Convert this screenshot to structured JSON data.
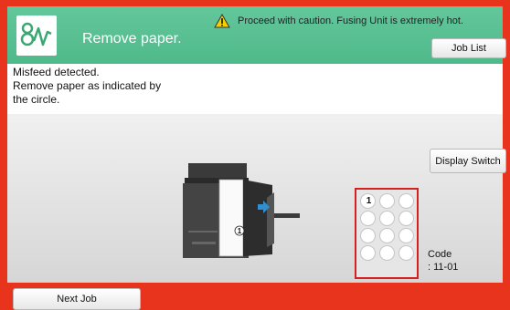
{
  "header": {
    "title": "Remove paper.",
    "warning": "Proceed with caution. Fusing Unit is extremely hot.",
    "job_list_label": "Job List"
  },
  "message": {
    "lines": [
      "Misfeed detected.",
      "Remove paper as indicated by",
      "the circle."
    ]
  },
  "panel": {
    "display_switch_label": "Display Switch",
    "printer_marker": "1",
    "location_marker": "1",
    "code_label": "Code",
    "code_value": ": 11-01"
  },
  "footer": {
    "next_job_label": "Next Job"
  },
  "colors": {
    "frame": "#e8341c",
    "header": "#56bf90",
    "highlight_box": "#d32020",
    "arrow": "#2f8fd0"
  },
  "icons": {
    "app": "misfeed-wave-icon",
    "warning": "warning-triangle-icon",
    "arrow": "right-arrow-icon"
  }
}
